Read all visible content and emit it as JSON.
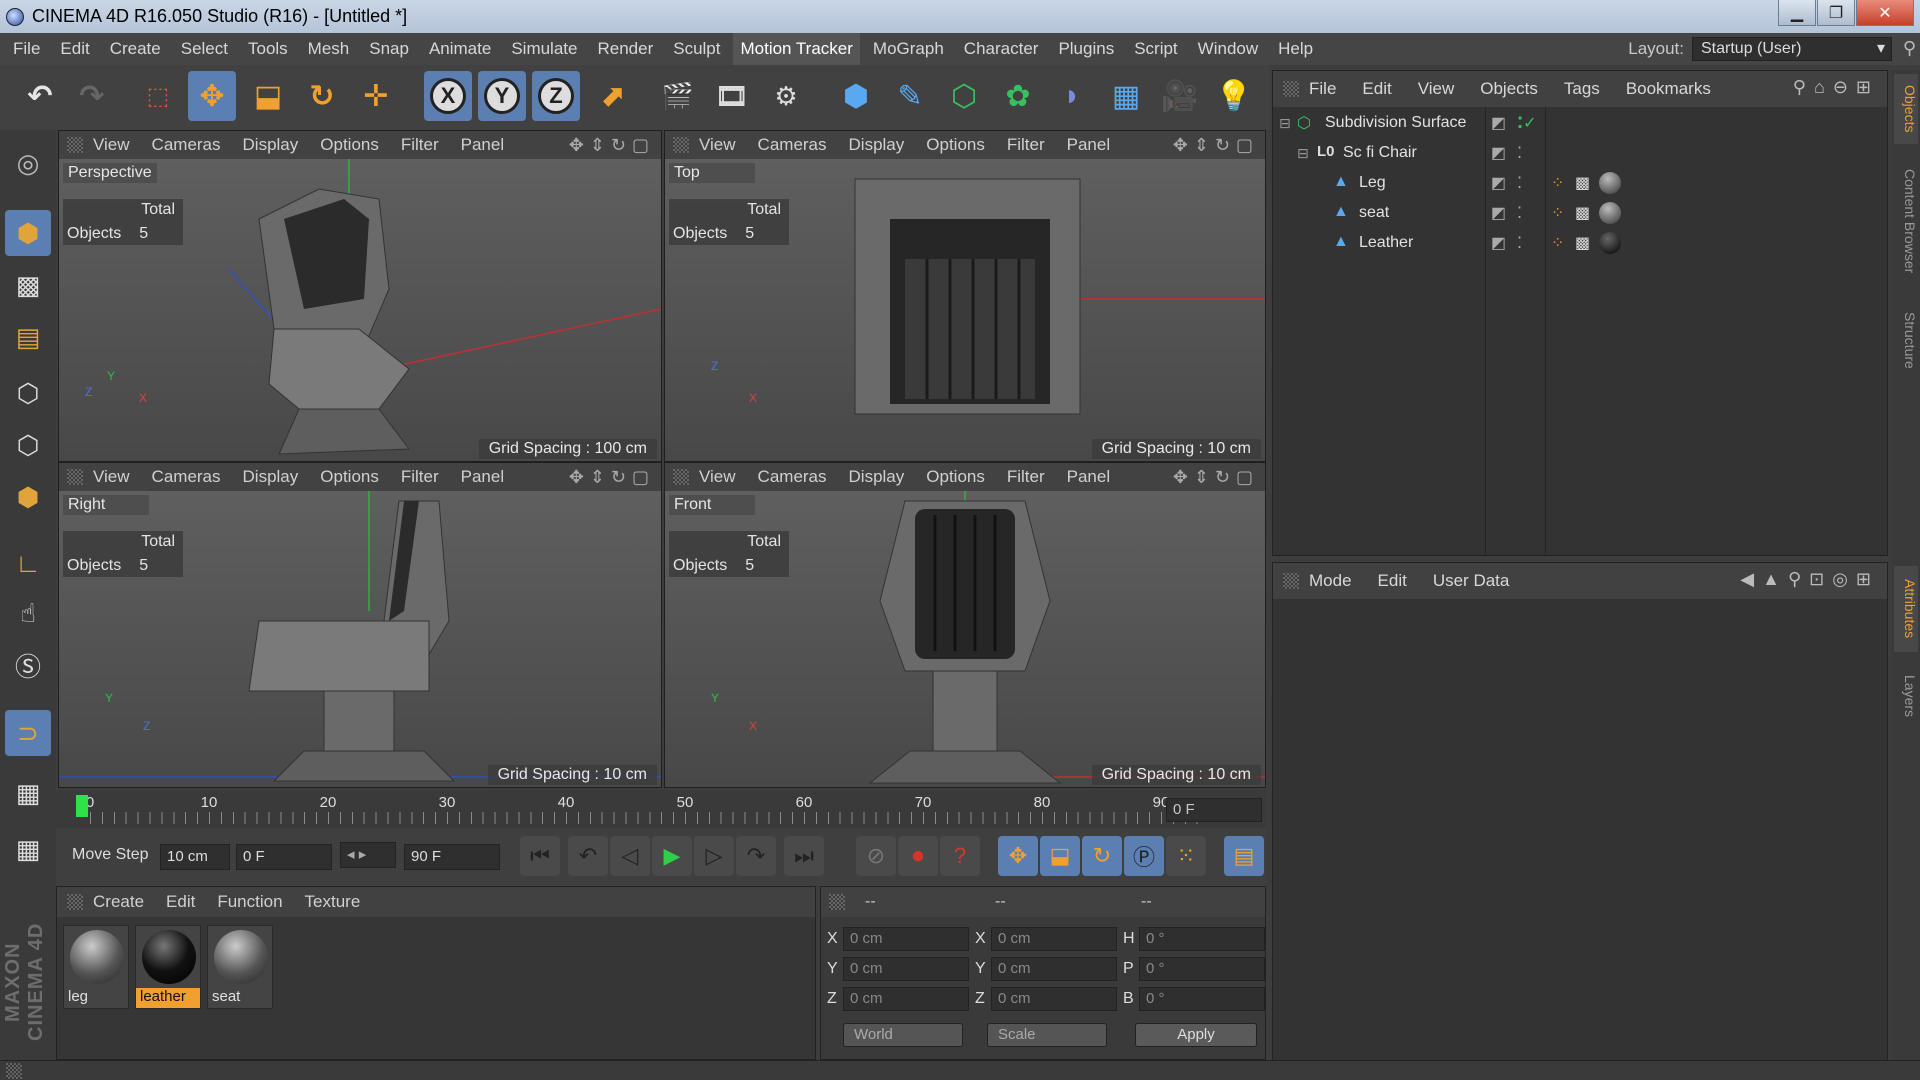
{
  "window": {
    "title": "CINEMA 4D R16.050 Studio (R16) - [Untitled *]",
    "min": "▁",
    "max": "❐",
    "close": "✕"
  },
  "menubar": {
    "items": [
      "File",
      "Edit",
      "Create",
      "Select",
      "Tools",
      "Mesh",
      "Snap",
      "Animate",
      "Simulate",
      "Render",
      "Sculpt",
      "Motion Tracker",
      "MoGraph",
      "Character",
      "Plugins",
      "Script",
      "Window",
      "Help"
    ],
    "layout_label": "Layout:",
    "layout_value": "Startup (User)"
  },
  "viewports": [
    {
      "name": "Perspective",
      "total": "Total",
      "objects_label": "Objects",
      "objects": "5",
      "grid": "Grid Spacing : 100 cm",
      "axes": [
        "Y",
        "Z",
        "X"
      ]
    },
    {
      "name": "Top",
      "total": "Total",
      "objects_label": "Objects",
      "objects": "5",
      "grid": "Grid Spacing : 10 cm",
      "axes": [
        "Z",
        "X"
      ]
    },
    {
      "name": "Right",
      "total": "Total",
      "objects_label": "Objects",
      "objects": "5",
      "grid": "Grid Spacing : 10 cm",
      "axes": [
        "Y",
        "Z"
      ]
    },
    {
      "name": "Front",
      "total": "Total",
      "objects_label": "Objects",
      "objects": "5",
      "grid": "Grid Spacing : 10 cm",
      "axes": [
        "Y",
        "X"
      ]
    }
  ],
  "viewport_menu": [
    "View",
    "Cameras",
    "Display",
    "Options",
    "Filter",
    "Panel"
  ],
  "timeline": {
    "ticks": [
      "0",
      "10",
      "20",
      "30",
      "40",
      "50",
      "60",
      "70",
      "80",
      "90"
    ],
    "current_frame": "0 F"
  },
  "transport": {
    "move_step_label": "Move Step",
    "move_step": "10 cm",
    "start": "0 F",
    "end": "90 F"
  },
  "material_manager": {
    "menu": [
      "Create",
      "Edit",
      "Function",
      "Texture"
    ],
    "materials": [
      {
        "label": "leg"
      },
      {
        "label": "leather"
      },
      {
        "label": "seat"
      }
    ]
  },
  "coordinates": {
    "headers": [
      "--",
      "--",
      "--"
    ],
    "rows": [
      {
        "l1": "X",
        "v1": "0 cm",
        "l2": "X",
        "v2": "0 cm",
        "l3": "H",
        "v3": "0 °"
      },
      {
        "l1": "Y",
        "v1": "0 cm",
        "l2": "Y",
        "v2": "0 cm",
        "l3": "P",
        "v3": "0 °"
      },
      {
        "l1": "Z",
        "v1": "0 cm",
        "l2": "Z",
        "v2": "0 cm",
        "l3": "B",
        "v3": "0 °"
      }
    ],
    "world": "World",
    "scale": "Scale",
    "apply": "Apply"
  },
  "object_manager": {
    "menu": [
      "File",
      "Edit",
      "View",
      "Objects",
      "Tags",
      "Bookmarks"
    ],
    "objects": [
      {
        "name": "Subdivision Surface"
      },
      {
        "name": "Sc fi Chair"
      },
      {
        "name": "Leg"
      },
      {
        "name": "seat"
      },
      {
        "name": "Leather"
      }
    ]
  },
  "attribute_manager": {
    "menu": [
      "Mode",
      "Edit",
      "User Data"
    ]
  },
  "right_tabs": [
    "Objects",
    "Content Browser",
    "Structure",
    "Attributes",
    "Layers"
  ],
  "logo": "MAXON CINEMA 4D"
}
